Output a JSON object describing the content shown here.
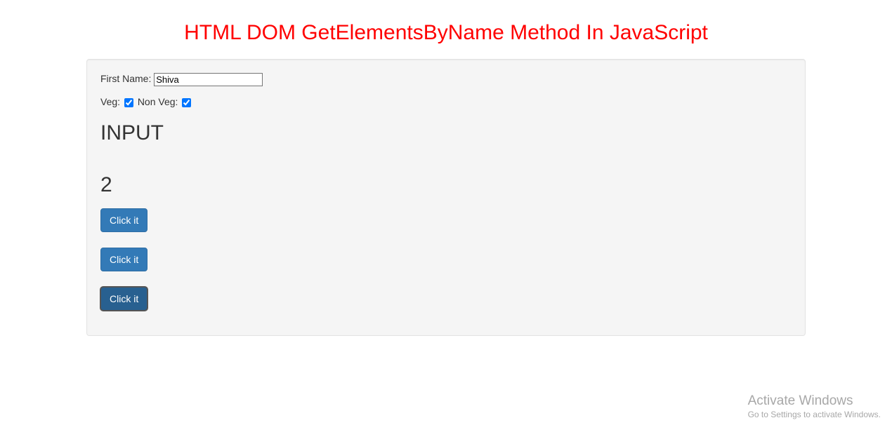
{
  "title": "HTML DOM GetElementsByName Method In JavaScript",
  "form": {
    "firstNameLabel": "First Name:",
    "firstNameValue": "Shiva",
    "vegLabel": "Veg:",
    "nonVegLabel": "Non Veg:",
    "vegChecked": true,
    "nonVegChecked": true
  },
  "result1": "INPUT",
  "result2": "2",
  "buttons": {
    "btn1": "Click it",
    "btn2": "Click it",
    "btn3": "Click it"
  },
  "watermark": {
    "title": "Activate Windows",
    "subtitle": "Go to Settings to activate Windows."
  }
}
